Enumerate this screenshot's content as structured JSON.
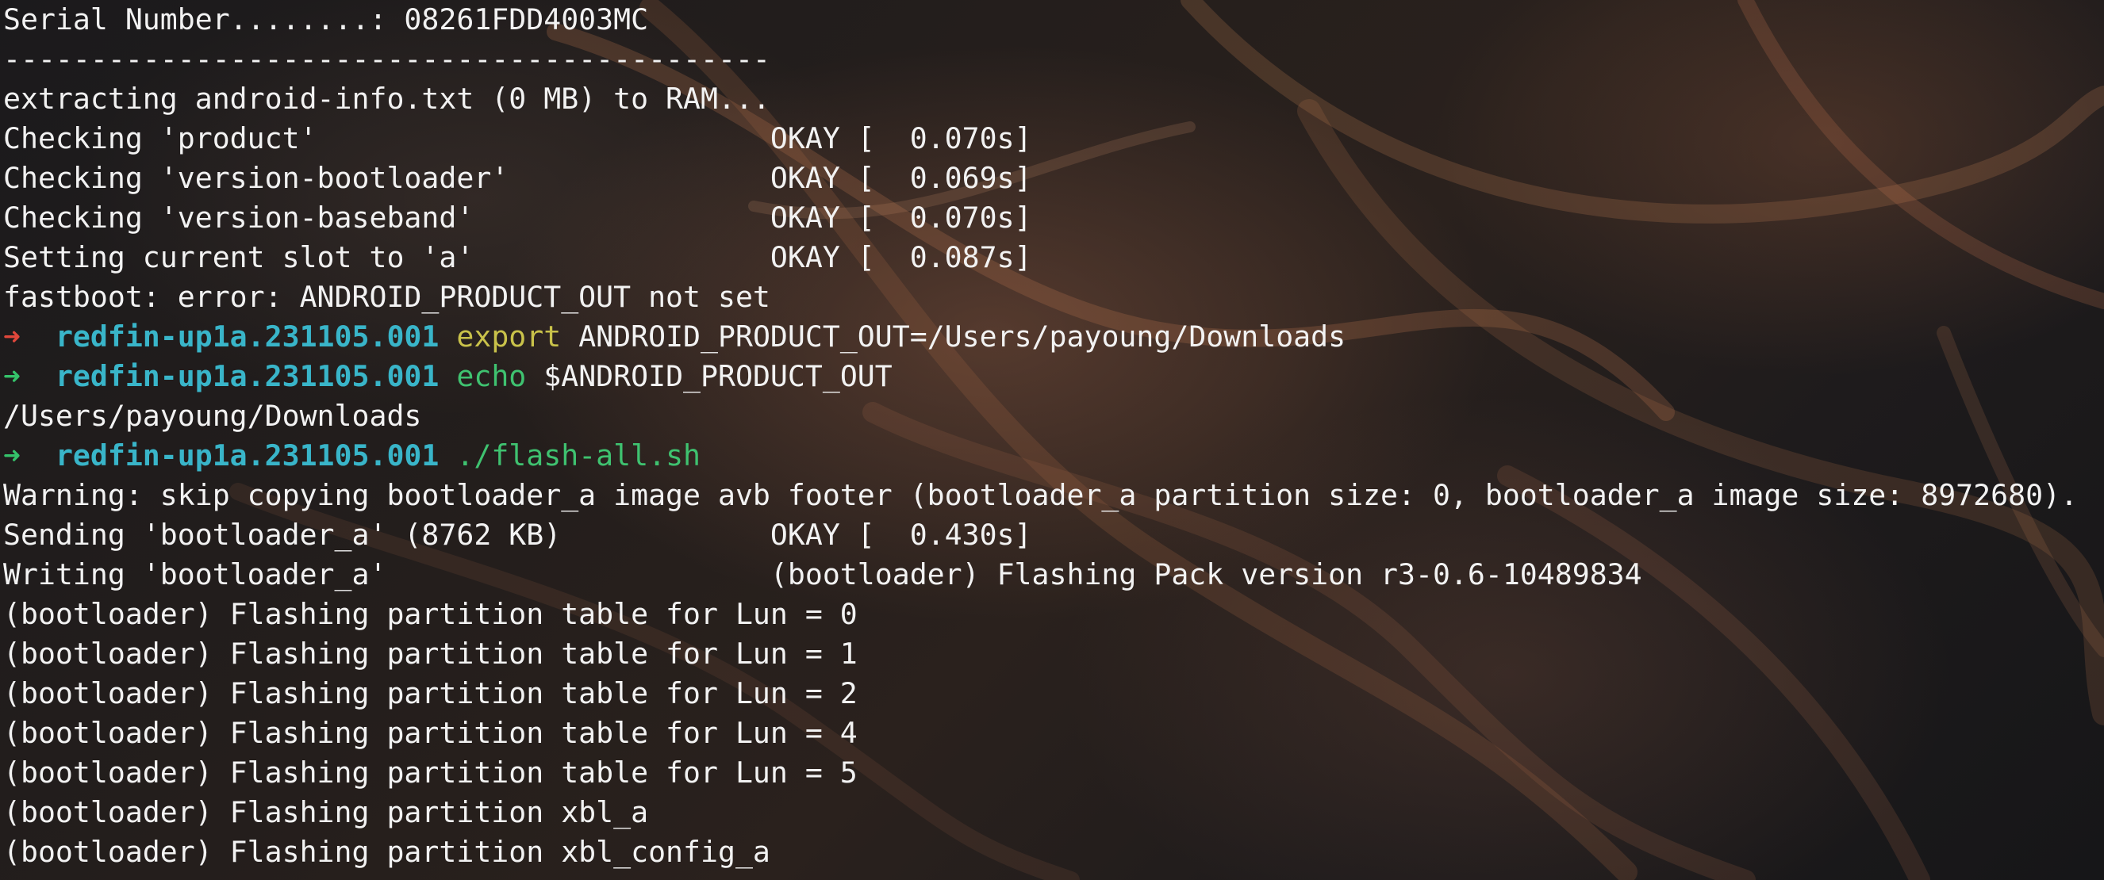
{
  "terminal": {
    "lines": [
      {
        "text": "Serial Number........: 08261FDD4003MC"
      },
      {
        "text": "--------------------------------------------"
      },
      {
        "text": "extracting android-info.txt (0 MB) to RAM..."
      },
      {
        "text": "Checking 'product'                          OKAY [  0.070s]"
      },
      {
        "text": "Checking 'version-bootloader'               OKAY [  0.069s]"
      },
      {
        "text": "Checking 'version-baseband'                 OKAY [  0.070s]"
      },
      {
        "text": "Setting current slot to 'a'                 OKAY [  0.087s]"
      },
      {
        "text": "fastboot: error: ANDROID_PRODUCT_OUT not set"
      },
      {
        "prompt": {
          "arrow": "➜",
          "status": "error",
          "cwd": "redfin-up1a.231105.001",
          "command": "export",
          "args": " ANDROID_PRODUCT_OUT=/Users/payoung/Downloads"
        }
      },
      {
        "prompt": {
          "arrow": "➜",
          "status": "ok",
          "cwd": "redfin-up1a.231105.001",
          "command": "echo",
          "args": " $ANDROID_PRODUCT_OUT"
        }
      },
      {
        "text": "/Users/payoung/Downloads"
      },
      {
        "prompt": {
          "arrow": "➜",
          "status": "ok",
          "cwd": "redfin-up1a.231105.001",
          "command": "./flash-all.sh",
          "args": ""
        }
      },
      {
        "text": "Warning: skip copying bootloader_a image avb footer (bootloader_a partition size: 0, bootloader_a image size: 8972680)."
      },
      {
        "text": "Sending 'bootloader_a' (8762 KB)            OKAY [  0.430s]"
      },
      {
        "text": "Writing 'bootloader_a'                      (bootloader) Flashing Pack version r3-0.6-10489834"
      },
      {
        "text": "(bootloader) Flashing partition table for Lun = 0"
      },
      {
        "text": "(bootloader) Flashing partition table for Lun = 1"
      },
      {
        "text": "(bootloader) Flashing partition table for Lun = 2"
      },
      {
        "text": "(bootloader) Flashing partition table for Lun = 4"
      },
      {
        "text": "(bootloader) Flashing partition table for Lun = 5"
      },
      {
        "text": "(bootloader) Flashing partition xbl_a"
      },
      {
        "text": "(bootloader) Flashing partition xbl_config_a"
      }
    ]
  },
  "colors": {
    "text": "#f2f2f2",
    "prompt_ok": "#35c26a",
    "prompt_error": "#e0473b",
    "cwd": "#39b5c9",
    "export_keyword": "#c9c24a",
    "echo_keyword": "#3fc270"
  }
}
